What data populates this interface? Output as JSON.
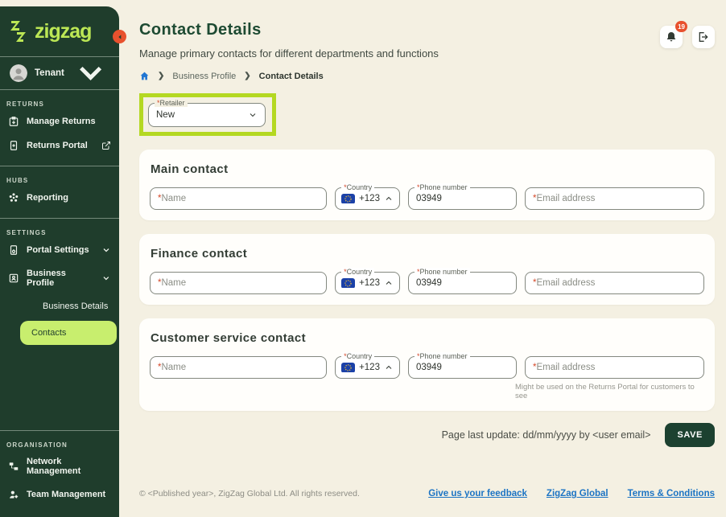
{
  "sidebar": {
    "logo_text": "zigzag",
    "tenant_label": "Tenant",
    "sections": {
      "returns": "RETURNS",
      "hubs": "HUBS",
      "settings": "SETTINGS",
      "organisation": "ORGANISATION"
    },
    "items": {
      "manage_returns": "Manage Returns",
      "returns_portal": "Returns Portal",
      "reporting": "Reporting",
      "portal_settings": "Portal Settings",
      "business_profile": "Business Profile",
      "business_details": "Business Details",
      "contacts": "Contacts",
      "network_management": "Network Management",
      "team_management": "Team Management"
    }
  },
  "header": {
    "title": "Contact Details",
    "subtitle": "Manage primary contacts for different departments and functions",
    "breadcrumb_1": "Business Profile",
    "breadcrumb_2": "Contact Details",
    "notification_count": "19"
  },
  "retailer": {
    "required_mark": "*",
    "label": "Retailer",
    "value": "New"
  },
  "form": {
    "required_mark": "*",
    "name_placeholder": "Name",
    "country_label": "Country",
    "country_code": "+123",
    "phone_label": "Phone number",
    "phone_value": "03949",
    "email_placeholder": "Email address"
  },
  "cards": {
    "main": {
      "title": "Main contact"
    },
    "finance": {
      "title": "Finance contact"
    },
    "customer": {
      "title": "Customer service contact",
      "email_helper": "Might be used on the Returns Portal for customers to see"
    }
  },
  "actions": {
    "last_update": "Page last update: dd/mm/yyyy by <user email>",
    "save": "SAVE"
  },
  "footer": {
    "copyright": "© <Published year>, ZigZag Global Ltd. All rights reserved.",
    "link_feedback": "Give us your feedback",
    "link_global": "ZigZag Global",
    "link_terms": "Terms & Conditions"
  },
  "colors": {
    "sidebar_bg": "#1f3d2c",
    "logo_green": "#bce755",
    "annotation_green": "#b4d822",
    "active_pill_green": "#c8ee6e",
    "title_green": "#1d4a32",
    "save_button_green": "#1c4130",
    "badge_orange": "#e8512e",
    "link_blue": "#1c74c4",
    "home_icon_blue": "#2176d2",
    "page_background": "#f4f0e2"
  }
}
